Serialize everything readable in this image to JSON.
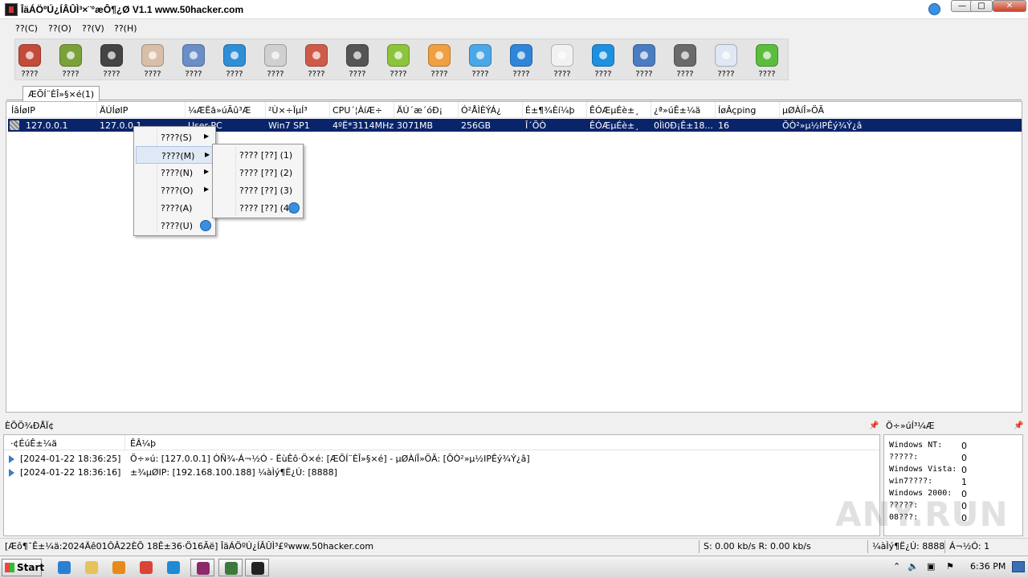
{
  "window": {
    "title": "ÎäÁÖºÚ¿ÍÂÛÌ³×¨°æÔ¶¿Ø V1.1 www.50hacker.com",
    "caption_min": "—",
    "caption_max": "□",
    "caption_close": "✕"
  },
  "menu": [
    "??(C)",
    "??(O)",
    "??(V)",
    "??(H)"
  ],
  "toolbar": {
    "items": [
      {
        "label": "????",
        "icon": "font-app-icon",
        "color": "#c44a3a"
      },
      {
        "label": "????",
        "icon": "drive-icon",
        "color": "#7aa23a"
      },
      {
        "label": "????",
        "icon": "terminal-icon",
        "color": "#444444"
      },
      {
        "label": "????",
        "icon": "sound-icon",
        "color": "#d9bfa8"
      },
      {
        "label": "????",
        "icon": "activity-icon",
        "color": "#6b8ec9"
      },
      {
        "label": "????",
        "icon": "appstore-icon",
        "color": "#2f8fd6"
      },
      {
        "label": "????",
        "icon": "camera-icon",
        "color": "#d0d0d0"
      },
      {
        "label": "????",
        "icon": "microphone-icon",
        "color": "#d05a4a"
      },
      {
        "label": "????",
        "icon": "clock-icon",
        "color": "#555555"
      },
      {
        "label": "????",
        "icon": "download-icon",
        "color": "#8cc43c"
      },
      {
        "label": "????",
        "icon": "star-icon",
        "color": "#f0a040"
      },
      {
        "label": "????",
        "icon": "cloud-icon",
        "color": "#4aa8e8"
      },
      {
        "label": "????",
        "icon": "chat-icon",
        "color": "#2e86d8"
      },
      {
        "label": "????",
        "icon": "calendar-icon",
        "color": "#f2f2f2"
      },
      {
        "label": "????",
        "icon": "skype-icon",
        "color": "#1e90e0"
      },
      {
        "label": "????",
        "icon": "globe-icon",
        "color": "#4a7cc2"
      },
      {
        "label": "????",
        "icon": "settings-icon",
        "color": "#6a6a6a"
      },
      {
        "label": "????",
        "icon": "checklist-icon",
        "color": "#dfe8f4"
      },
      {
        "label": "????",
        "icon": "phone-icon",
        "color": "#5cbc3c"
      }
    ]
  },
  "tab": {
    "label": "ÆÕÍ¨ÈÎ»§×é(1)"
  },
  "list": {
    "columns": [
      "ÍâÍøIP",
      "ÄÚÍøIP",
      "¼ÆËã»úÃû³Æ",
      "²Ù×÷ÏµÍ³",
      "CPU´¦ÀíÆ÷",
      "ÄÚ´æ´óÐ¡",
      "Ó²ÅÌÈÝÁ¿",
      "É±¶¾Èí¼þ",
      "ÊÓÆµÉè±¸",
      "¿ª»úÊ±¼ä",
      "ÍøÂçping",
      "µØÀíÎ»ÖÃ"
    ],
    "row": [
      "127.0.0.1",
      "127.0.0.1",
      "User-PC",
      "Win7 SP1",
      "4ºË*3114MHz",
      "3071MB",
      "256GB",
      "Î´ÕÒ",
      "ÊÓÆµÉè±¸",
      "0Ìì0Ð¡Ê±18...",
      "16",
      "ÕÒ²»µ½IPÊý¾Ý¿â"
    ]
  },
  "context_menu": {
    "items": [
      {
        "label": "????(S)",
        "submenu": true
      },
      {
        "label": "????(M)",
        "submenu": true
      },
      {
        "label": "????(N)",
        "submenu": true
      },
      {
        "label": "????(O)",
        "submenu": true
      },
      {
        "label": "????(A)",
        "submenu": false
      },
      {
        "label": "????(U)",
        "submenu": false
      }
    ],
    "submenu_items": [
      "???? [??] (1)",
      "???? [??] (2)",
      "???? [??] (3)",
      "???? [??] (4)"
    ]
  },
  "log": {
    "title": "ÈÕÖ¾ÐÅÏ¢",
    "col_time": "·¢ÉúÊ±¼ä",
    "col_event": "ÊÂ¼þ",
    "rows": [
      {
        "time": "[2024-01-22 18:36:25]",
        "event": "Ö÷»ú: [127.0.0.1] ÒÑ¾-Á¬½Ó - ËùÊô·Ö×é: [ÆÕÍ¨ÈÎ»§×é] - µØÀíÎ»ÖÃ: [ÕÒ²»µ½IPÊý¾Ý¿â]"
      },
      {
        "time": "[2024-01-22 18:36:16]",
        "event": "±¾µØIP: [192.168.100.188] ¼àÌý¶Ë¿Ú: [8888]"
      }
    ]
  },
  "stats": {
    "title": "Ö÷»úÍ³¼Æ",
    "rows": [
      {
        "label": "Windows NT:",
        "value": "0"
      },
      {
        "label": "?????:",
        "value": "0"
      },
      {
        "label": "Windows Vista:",
        "value": "0"
      },
      {
        "label": "win7????:",
        "value": "1"
      },
      {
        "label": "Windows 2000:",
        "value": "0"
      },
      {
        "label": "?????:",
        "value": "0"
      },
      {
        "label": "08???:",
        "value": "0"
      }
    ]
  },
  "statusbar": {
    "left": "[Æô¶¯Ê±¼ä:2024Äê01ÔÂ22ÈÕ 18Ê±36·Ö16Ãë]   ÎäÁÖºÚ¿ÍÂÛÌ³£ºwww.50hacker.com",
    "speed": "S: 0.00 kb/s R: 0.00 kb/s",
    "port": "¼àÌý¶Ë¿Ú: 8888",
    "online": "Á¬½Ó: 1"
  },
  "taskbar": {
    "start": "Start",
    "clock": "6:36 PM",
    "apps": [
      {
        "icon": "ie-icon",
        "color": "#2a7fd4"
      },
      {
        "icon": "explorer-icon",
        "color": "#e8c25a"
      },
      {
        "icon": "media-player-icon",
        "color": "#e88a1a"
      },
      {
        "icon": "chrome-icon",
        "color": "#db4437"
      },
      {
        "icon": "edge-icon",
        "color": "#1f8ad6"
      },
      {
        "icon": "winrar-icon",
        "color": "#8a2a6a"
      },
      {
        "icon": "network-app-icon",
        "color": "#3c7a3c"
      },
      {
        "icon": "remote-app-icon",
        "color": "#222222"
      }
    ]
  },
  "watermark": "ANY.RUN"
}
